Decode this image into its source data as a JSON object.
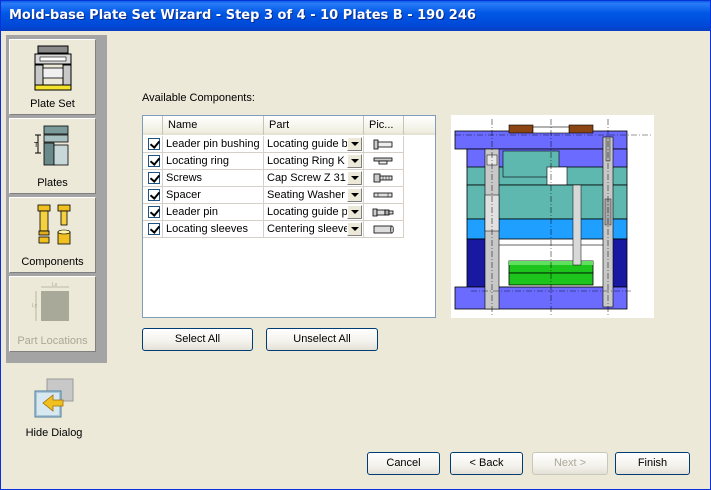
{
  "window": {
    "title": "Mold-base Plate Set Wizard - Step 3 of 4  - 10 Plates B - 190 246"
  },
  "sidebar": {
    "items": [
      {
        "label": "Plate Set",
        "icon": "plate-set-icon",
        "enabled": true
      },
      {
        "label": "Plates",
        "icon": "plates-icon",
        "enabled": true
      },
      {
        "label": "Components",
        "icon": "components-icon",
        "enabled": true
      },
      {
        "label": "Part Locations",
        "icon": "part-locations-icon",
        "enabled": false
      }
    ],
    "hide_dialog_label": "Hide Dialog"
  },
  "components": {
    "label": "Available Components:",
    "columns": [
      "Name",
      "Part",
      "Pic..."
    ],
    "rows": [
      {
        "checked": true,
        "name": "Leader pin bushing",
        "part": "Locating guide b...",
        "pic": "bushing-icon"
      },
      {
        "checked": true,
        "name": "Locating ring",
        "part": "Locating Ring K ...",
        "pic": "ring-icon"
      },
      {
        "checked": true,
        "name": "Screws",
        "part": "Cap Screw Z 31",
        "pic": "screw-icon"
      },
      {
        "checked": true,
        "name": "Spacer",
        "part": "Seating Washer ...",
        "pic": "washer-icon"
      },
      {
        "checked": true,
        "name": "Leader pin",
        "part": "Locating guide pi",
        "pic": "pin-icon"
      },
      {
        "checked": true,
        "name": "Locating sleeves",
        "part": "Centering sleeve",
        "pic": "sleeve-icon"
      }
    ]
  },
  "buttons": {
    "select_all": "Select All",
    "unselect_all": "Unselect All",
    "cancel": "Cancel",
    "back": "< Back",
    "next": "Next >",
    "finish": "Finish"
  },
  "colors": {
    "titlebar": "#0058e6",
    "mold_blue": "#6b6bff",
    "mold_teal": "#5fb8b0",
    "mold_green": "#1cc41c",
    "mold_darkblue": "#1818a0",
    "mold_brown": "#8b4513"
  }
}
